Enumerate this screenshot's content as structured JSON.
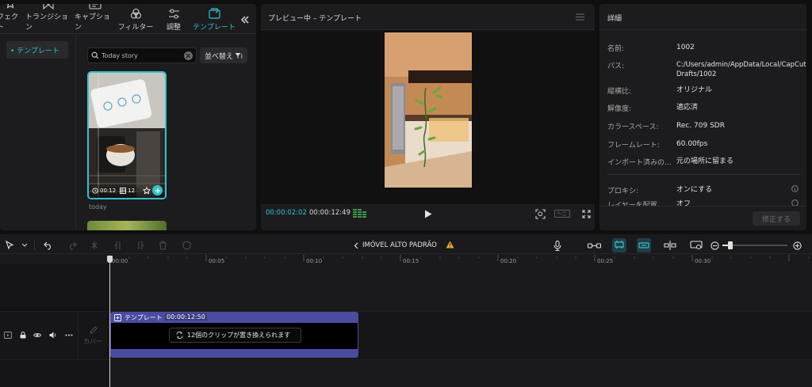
{
  "media_tabs": {
    "items": [
      {
        "label": "フェクト",
        "icon": "effects-icon"
      },
      {
        "label": "トランジション",
        "icon": "transition-icon"
      },
      {
        "label": "キャプション",
        "icon": "caption-icon"
      },
      {
        "label": "フィルター",
        "icon": "filter-icon"
      },
      {
        "label": "調整",
        "icon": "adjust-icon"
      },
      {
        "label": "テンプレート",
        "icon": "template-icon"
      }
    ],
    "collapse_icon": "double-chevron-left-icon"
  },
  "sidebar": {
    "items": [
      {
        "label": "• テンプレート"
      }
    ]
  },
  "search": {
    "value": "Today story"
  },
  "sort_button": {
    "label": "並べ替え"
  },
  "template_card": {
    "duration": "00:12",
    "clips": "12",
    "section_label": "today"
  },
  "preview": {
    "title": "プレビュー中 – テンプレート",
    "current_time": "00:00:02:02",
    "total_time": "00:00:12:49"
  },
  "details": {
    "title": "詳細",
    "rows": [
      {
        "key": "名前:",
        "value": "1002"
      },
      {
        "key": "パス:",
        "value": "C:/Users/admin/AppData/Local/CapCut Drafts/1002"
      },
      {
        "key": "縦横比:",
        "value": "オリジナル"
      },
      {
        "key": "解像度:",
        "value": "適応済"
      },
      {
        "key": "カラースペース:",
        "value": "Rec. 709 SDR"
      },
      {
        "key": "フレームレート:",
        "value": "60.00fps"
      },
      {
        "key": "インポート済みの…",
        "value": "元の場所に留まる"
      }
    ],
    "proxy": {
      "key": "プロキシ:",
      "value": "オンにする"
    },
    "layer": {
      "key": "レイヤーを配置",
      "value": "オフ"
    },
    "apply_button": "修正する"
  },
  "timeline": {
    "project_title": "IMÓVEL ALTO PADRÃO",
    "ticks": [
      "00:00",
      "00:05",
      "00:10",
      "00:15",
      "00:20",
      "00:25",
      "00:30"
    ],
    "cover_label": "カバー",
    "clip": {
      "label": "テンプレート",
      "duration": "00:00:12:50",
      "replace_message": "12個のクリップが置き換えられます"
    }
  },
  "colors": {
    "accent": "#35c2cc",
    "clip": "#4b4ba0",
    "bg": "#0f0f10",
    "panel": "#1c1c1e"
  }
}
